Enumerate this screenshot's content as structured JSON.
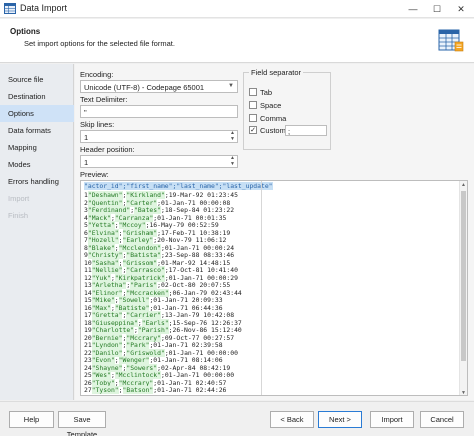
{
  "window": {
    "title": "Data Import",
    "minimize": "—",
    "maximize": "☐",
    "close": "✕"
  },
  "header": {
    "title": "Options",
    "subtitle": "Set import options for the selected file format."
  },
  "sidebar": {
    "items": [
      {
        "label": "Source file",
        "state": "normal"
      },
      {
        "label": "Destination",
        "state": "normal"
      },
      {
        "label": "Options",
        "state": "active"
      },
      {
        "label": "Data formats",
        "state": "normal"
      },
      {
        "label": "Mapping",
        "state": "normal"
      },
      {
        "label": "Modes",
        "state": "normal"
      },
      {
        "label": "Errors handling",
        "state": "normal"
      },
      {
        "label": "Import",
        "state": "disabled"
      },
      {
        "label": "Finish",
        "state": "disabled"
      }
    ]
  },
  "options": {
    "encoding_label": "Encoding:",
    "encoding_value": "Unicode (UTF-8) - Codepage 65001",
    "text_delimiter_label": "Text Delimiter:",
    "text_delimiter_value": "\"",
    "skip_lines_label": "Skip lines:",
    "skip_lines_value": "1",
    "header_position_label": "Header position:",
    "header_position_value": "1",
    "preview_label": "Preview:"
  },
  "field_separator": {
    "title": "Field separator",
    "tab_label": "Tab",
    "space_label": "Space",
    "comma_label": "Comma",
    "custom_label": "Custom",
    "custom_value": ";",
    "custom_checked": "✓"
  },
  "preview": {
    "header_line": "\"actor_id\";\"first_name\";\"last_name\";\"last_update\"",
    "lines": [
      "1\"Deshawn\";\"Kirkland\";19-Mar-92 01:23:45",
      "2\"Quentin\";\"Carter\";01-Jan-71 00:00:08",
      "3\"Ferdinand\";\"Bates\";18-Sep-84 01:23:22",
      "4\"Mack\";\"Carranza\";01-Jan-71 00:01:35",
      "5\"Yetta\";\"Mccoy\";16-May-79 00:52:59",
      "6\"Elvina\";\"Grisham\";17-Feb-71 10:38:19",
      "7\"Hozell\";\"Earley\";20-Nov-79 11:06:12",
      "8\"Blake\";\"Mcclendon\";01-Jan-71 00:00:24",
      "9\"Christy\";\"Batista\";23-Sep-88 08:33:46",
      "10\"Sasha\";\"Grissom\";01-Mar-92 14:48:15",
      "11\"Nellie\";\"Carrasco\";17-Oct-81 10:41:40",
      "12\"Yuk\";\"Kirkpatrick\";01-Jan-71 00:00:29",
      "13\"Arletha\";\"Paris\";02-Oct-80 20:07:55",
      "14\"Elinor\";\"Mccracken\";06-Jan-79 02:43:44",
      "15\"Mike\";\"Sowell\";01-Jan-71 20:09:33",
      "16\"Max\";\"Batiste\";01-Jan-71 06:44:36",
      "17\"Gretta\";\"Carrier\";13-Jan-79 10:42:08",
      "18\"Giuseppina\";\"Earls\";15-Sep-76 12:26:37",
      "19\"Charlotte\";\"Parish\";26-Nov-86 15:12:40",
      "20\"Bernie\";\"Mccrary\";09-Oct-77 00:27:57",
      "21\"Lyndon\";\"Park\";01-Jan-71 02:39:58",
      "22\"Danilo\";\"Griswold\";01-Jan-71 00:00:00",
      "23\"Evon\";\"Wenger\";01-Jan-71 08:14:06",
      "24\"Shayne\";\"Sowers\";02-Apr-84 08:42:19",
      "25\"Wes\";\"Mcclintock\";01-Jan-71 00:00:00",
      "26\"Toby\";\"Mccrary\";01-Jan-71 02:40:57",
      "27\"Tyson\";\"Batson\";01-Jan-71 02:44:26"
    ]
  },
  "footer": {
    "help": "Help",
    "save_template": "Save Template",
    "back": "< Back",
    "next": "Next >",
    "import": "Import",
    "cancel": "Cancel"
  },
  "colors": {
    "accent": "#2a7bd4",
    "active_item": "#cfe2f7",
    "quote_highlight": "#dff5df",
    "header_highlight": "#c6dff5"
  }
}
